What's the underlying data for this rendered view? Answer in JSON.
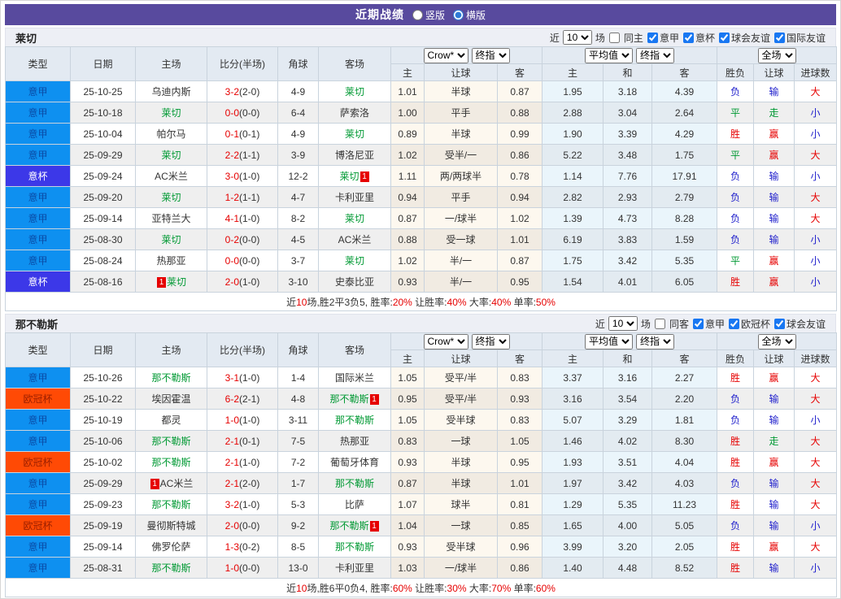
{
  "header": {
    "title": "近期战绩",
    "radio_vertical": "竖版",
    "radio_horizontal": "横版"
  },
  "table_header": {
    "cols": [
      "类型",
      "日期",
      "主场",
      "比分(半场)",
      "角球",
      "客场"
    ],
    "selects": {
      "book": "Crow*",
      "final1": "终指",
      "avg": "平均值",
      "final2": "终指",
      "scope": "全场"
    },
    "sub": [
      "主",
      "让球",
      "客",
      "主",
      "和",
      "客",
      "胜负",
      "让球",
      "进球数"
    ]
  },
  "sections": [
    {
      "team": "莱切",
      "filter": {
        "near": "近",
        "num": "10",
        "games": "场",
        "same": "同主",
        "leagues": [
          "意甲",
          "意杯",
          "球会友谊",
          "国际友谊"
        ]
      },
      "rows": [
        {
          "type": "意甲",
          "tc": "sa",
          "date": "25-10-25",
          "home": {
            "name": "乌迪内斯"
          },
          "ft": "3-2",
          "ht": "(2-0)",
          "corner": "4-9",
          "away": {
            "name": "莱切",
            "self": true
          },
          "odds": [
            "1.01",
            "半球",
            "0.87",
            "1.95",
            "3.18",
            "4.39"
          ],
          "res": [
            {
              "t": "负",
              "c": "b"
            },
            {
              "t": "输",
              "c": "b"
            },
            {
              "t": "大",
              "c": "r"
            }
          ]
        },
        {
          "type": "意甲",
          "tc": "sa",
          "date": "25-10-18",
          "home": {
            "name": "莱切",
            "self": true
          },
          "ft": "0-0",
          "ht": "(0-0)",
          "corner": "6-4",
          "away": {
            "name": "萨索洛"
          },
          "odds": [
            "1.00",
            "平手",
            "0.88",
            "2.88",
            "3.04",
            "2.64"
          ],
          "res": [
            {
              "t": "平",
              "c": "g"
            },
            {
              "t": "走",
              "c": "g"
            },
            {
              "t": "小",
              "c": "b"
            }
          ]
        },
        {
          "type": "意甲",
          "tc": "sa",
          "date": "25-10-04",
          "home": {
            "name": "帕尔马"
          },
          "ft": "0-1",
          "ht": "(0-1)",
          "corner": "4-9",
          "away": {
            "name": "莱切",
            "self": true
          },
          "odds": [
            "0.89",
            "半球",
            "0.99",
            "1.90",
            "3.39",
            "4.29"
          ],
          "res": [
            {
              "t": "胜",
              "c": "r"
            },
            {
              "t": "赢",
              "c": "r"
            },
            {
              "t": "小",
              "c": "b"
            }
          ]
        },
        {
          "type": "意甲",
          "tc": "sa",
          "date": "25-09-29",
          "home": {
            "name": "莱切",
            "self": true
          },
          "ft": "2-2",
          "ht": "(1-1)",
          "corner": "3-9",
          "away": {
            "name": "博洛尼亚"
          },
          "odds": [
            "1.02",
            "受半/一",
            "0.86",
            "5.22",
            "3.48",
            "1.75"
          ],
          "res": [
            {
              "t": "平",
              "c": "g"
            },
            {
              "t": "赢",
              "c": "r"
            },
            {
              "t": "大",
              "c": "r"
            }
          ]
        },
        {
          "type": "意杯",
          "tc": "ci",
          "date": "25-09-24",
          "home": {
            "name": "AC米兰"
          },
          "ft": "3-0",
          "ht": "(1-0)",
          "corner": "12-2",
          "away": {
            "name": "莱切",
            "self": true,
            "card": "1"
          },
          "odds": [
            "1.11",
            "两/两球半",
            "0.78",
            "1.14",
            "7.76",
            "17.91"
          ],
          "res": [
            {
              "t": "负",
              "c": "b"
            },
            {
              "t": "输",
              "c": "b"
            },
            {
              "t": "小",
              "c": "b"
            }
          ]
        },
        {
          "type": "意甲",
          "tc": "sa",
          "date": "25-09-20",
          "home": {
            "name": "莱切",
            "self": true
          },
          "ft": "1-2",
          "ht": "(1-1)",
          "corner": "4-7",
          "away": {
            "name": "卡利亚里"
          },
          "odds": [
            "0.94",
            "平手",
            "0.94",
            "2.82",
            "2.93",
            "2.79"
          ],
          "res": [
            {
              "t": "负",
              "c": "b"
            },
            {
              "t": "输",
              "c": "b"
            },
            {
              "t": "大",
              "c": "r"
            }
          ]
        },
        {
          "type": "意甲",
          "tc": "sa",
          "date": "25-09-14",
          "home": {
            "name": "亚特兰大"
          },
          "ft": "4-1",
          "ht": "(1-0)",
          "corner": "8-2",
          "away": {
            "name": "莱切",
            "self": true
          },
          "odds": [
            "0.87",
            "一/球半",
            "1.02",
            "1.39",
            "4.73",
            "8.28"
          ],
          "res": [
            {
              "t": "负",
              "c": "b"
            },
            {
              "t": "输",
              "c": "b"
            },
            {
              "t": "大",
              "c": "r"
            }
          ]
        },
        {
          "type": "意甲",
          "tc": "sa",
          "date": "25-08-30",
          "home": {
            "name": "莱切",
            "self": true
          },
          "ft": "0-2",
          "ht": "(0-0)",
          "corner": "4-5",
          "away": {
            "name": "AC米兰"
          },
          "odds": [
            "0.88",
            "受一球",
            "1.01",
            "6.19",
            "3.83",
            "1.59"
          ],
          "res": [
            {
              "t": "负",
              "c": "b"
            },
            {
              "t": "输",
              "c": "b"
            },
            {
              "t": "小",
              "c": "b"
            }
          ]
        },
        {
          "type": "意甲",
          "tc": "sa",
          "date": "25-08-24",
          "home": {
            "name": "热那亚"
          },
          "ft": "0-0",
          "ht": "(0-0)",
          "corner": "3-7",
          "away": {
            "name": "莱切",
            "self": true
          },
          "odds": [
            "1.02",
            "半/一",
            "0.87",
            "1.75",
            "3.42",
            "5.35"
          ],
          "res": [
            {
              "t": "平",
              "c": "g"
            },
            {
              "t": "赢",
              "c": "r"
            },
            {
              "t": "小",
              "c": "b"
            }
          ]
        },
        {
          "type": "意杯",
          "tc": "ci",
          "date": "25-08-16",
          "home": {
            "name": "莱切",
            "self": true,
            "card": "1"
          },
          "ft": "2-0",
          "ht": "(1-0)",
          "corner": "3-10",
          "away": {
            "name": "史泰比亚"
          },
          "odds": [
            "0.93",
            "半/一",
            "0.95",
            "1.54",
            "4.01",
            "6.05"
          ],
          "res": [
            {
              "t": "胜",
              "c": "r"
            },
            {
              "t": "赢",
              "c": "r"
            },
            {
              "t": "小",
              "c": "b"
            }
          ]
        }
      ],
      "summary": [
        {
          "t": "近",
          "c": "k"
        },
        {
          "t": "10",
          "c": "r"
        },
        {
          "t": "场,胜2平3负5, 胜率:",
          "c": "k"
        },
        {
          "t": "20%",
          "c": "r"
        },
        {
          "t": " 让胜率:",
          "c": "k"
        },
        {
          "t": "40%",
          "c": "r"
        },
        {
          "t": " 大率:",
          "c": "k"
        },
        {
          "t": "40%",
          "c": "r"
        },
        {
          "t": " 单率:",
          "c": "k"
        },
        {
          "t": "50%",
          "c": "r"
        }
      ]
    },
    {
      "team": "那不勒斯",
      "filter": {
        "near": "近",
        "num": "10",
        "games": "场",
        "same": "同客",
        "leagues": [
          "意甲",
          "欧冠杯",
          "球会友谊"
        ]
      },
      "rows": [
        {
          "type": "意甲",
          "tc": "sa",
          "date": "25-10-26",
          "home": {
            "name": "那不勒斯",
            "self": true
          },
          "ft": "3-1",
          "ht": "(1-0)",
          "corner": "1-4",
          "away": {
            "name": "国际米兰"
          },
          "odds": [
            "1.05",
            "受平/半",
            "0.83",
            "3.37",
            "3.16",
            "2.27"
          ],
          "res": [
            {
              "t": "胜",
              "c": "r"
            },
            {
              "t": "赢",
              "c": "r"
            },
            {
              "t": "大",
              "c": "r"
            }
          ]
        },
        {
          "type": "欧冠杯",
          "tc": "ucl",
          "date": "25-10-22",
          "home": {
            "name": "埃因霍温"
          },
          "ft": "6-2",
          "ht": "(2-1)",
          "corner": "4-8",
          "away": {
            "name": "那不勒斯",
            "self": true,
            "card": "1"
          },
          "odds": [
            "0.95",
            "受平/半",
            "0.93",
            "3.16",
            "3.54",
            "2.20"
          ],
          "res": [
            {
              "t": "负",
              "c": "b"
            },
            {
              "t": "输",
              "c": "b"
            },
            {
              "t": "大",
              "c": "r"
            }
          ]
        },
        {
          "type": "意甲",
          "tc": "sa",
          "date": "25-10-19",
          "home": {
            "name": "都灵"
          },
          "ft": "1-0",
          "ht": "(1-0)",
          "corner": "3-11",
          "away": {
            "name": "那不勒斯",
            "self": true
          },
          "odds": [
            "1.05",
            "受半球",
            "0.83",
            "5.07",
            "3.29",
            "1.81"
          ],
          "res": [
            {
              "t": "负",
              "c": "b"
            },
            {
              "t": "输",
              "c": "b"
            },
            {
              "t": "小",
              "c": "b"
            }
          ]
        },
        {
          "type": "意甲",
          "tc": "sa",
          "date": "25-10-06",
          "home": {
            "name": "那不勒斯",
            "self": true
          },
          "ft": "2-1",
          "ht": "(0-1)",
          "corner": "7-5",
          "away": {
            "name": "热那亚"
          },
          "odds": [
            "0.83",
            "一球",
            "1.05",
            "1.46",
            "4.02",
            "8.30"
          ],
          "res": [
            {
              "t": "胜",
              "c": "r"
            },
            {
              "t": "走",
              "c": "g"
            },
            {
              "t": "大",
              "c": "r"
            }
          ]
        },
        {
          "type": "欧冠杯",
          "tc": "ucl",
          "date": "25-10-02",
          "home": {
            "name": "那不勒斯",
            "self": true
          },
          "ft": "2-1",
          "ht": "(1-0)",
          "corner": "7-2",
          "away": {
            "name": "葡萄牙体育"
          },
          "odds": [
            "0.93",
            "半球",
            "0.95",
            "1.93",
            "3.51",
            "4.04"
          ],
          "res": [
            {
              "t": "胜",
              "c": "r"
            },
            {
              "t": "赢",
              "c": "r"
            },
            {
              "t": "大",
              "c": "r"
            }
          ]
        },
        {
          "type": "意甲",
          "tc": "sa",
          "date": "25-09-29",
          "home": {
            "name": "AC米兰",
            "card": "1"
          },
          "ft": "2-1",
          "ht": "(2-0)",
          "corner": "1-7",
          "away": {
            "name": "那不勒斯",
            "self": true
          },
          "odds": [
            "0.87",
            "半球",
            "1.01",
            "1.97",
            "3.42",
            "4.03"
          ],
          "res": [
            {
              "t": "负",
              "c": "b"
            },
            {
              "t": "输",
              "c": "b"
            },
            {
              "t": "大",
              "c": "r"
            }
          ]
        },
        {
          "type": "意甲",
          "tc": "sa",
          "date": "25-09-23",
          "home": {
            "name": "那不勒斯",
            "self": true
          },
          "ft": "3-2",
          "ht": "(1-0)",
          "corner": "5-3",
          "away": {
            "name": "比萨"
          },
          "odds": [
            "1.07",
            "球半",
            "0.81",
            "1.29",
            "5.35",
            "11.23"
          ],
          "res": [
            {
              "t": "胜",
              "c": "r"
            },
            {
              "t": "输",
              "c": "b"
            },
            {
              "t": "大",
              "c": "r"
            }
          ]
        },
        {
          "type": "欧冠杯",
          "tc": "ucl",
          "date": "25-09-19",
          "home": {
            "name": "曼彻斯特城"
          },
          "ft": "2-0",
          "ht": "(0-0)",
          "corner": "9-2",
          "away": {
            "name": "那不勒斯",
            "self": true,
            "card": "1"
          },
          "odds": [
            "1.04",
            "一球",
            "0.85",
            "1.65",
            "4.00",
            "5.05"
          ],
          "res": [
            {
              "t": "负",
              "c": "b"
            },
            {
              "t": "输",
              "c": "b"
            },
            {
              "t": "小",
              "c": "b"
            }
          ]
        },
        {
          "type": "意甲",
          "tc": "sa",
          "date": "25-09-14",
          "home": {
            "name": "佛罗伦萨"
          },
          "ft": "1-3",
          "ht": "(0-2)",
          "corner": "8-5",
          "away": {
            "name": "那不勒斯",
            "self": true
          },
          "odds": [
            "0.93",
            "受半球",
            "0.96",
            "3.99",
            "3.20",
            "2.05"
          ],
          "res": [
            {
              "t": "胜",
              "c": "r"
            },
            {
              "t": "赢",
              "c": "r"
            },
            {
              "t": "大",
              "c": "r"
            }
          ]
        },
        {
          "type": "意甲",
          "tc": "sa",
          "date": "25-08-31",
          "home": {
            "name": "那不勒斯",
            "self": true
          },
          "ft": "1-0",
          "ht": "(0-0)",
          "corner": "13-0",
          "away": {
            "name": "卡利亚里"
          },
          "odds": [
            "1.03",
            "一/球半",
            "0.86",
            "1.40",
            "4.48",
            "8.52"
          ],
          "res": [
            {
              "t": "胜",
              "c": "r"
            },
            {
              "t": "输",
              "c": "b"
            },
            {
              "t": "小",
              "c": "b"
            }
          ]
        }
      ],
      "summary": [
        {
          "t": "近",
          "c": "k"
        },
        {
          "t": "10",
          "c": "r"
        },
        {
          "t": "场,胜6平0负4, 胜率:",
          "c": "k"
        },
        {
          "t": "60%",
          "c": "r"
        },
        {
          "t": " 让胜率:",
          "c": "k"
        },
        {
          "t": "30%",
          "c": "r"
        },
        {
          "t": " 大率:",
          "c": "k"
        },
        {
          "t": "70%",
          "c": "r"
        },
        {
          "t": " 单率:",
          "c": "k"
        },
        {
          "t": "60%",
          "c": "r"
        }
      ]
    }
  ],
  "colors": {
    "accent_purple": "#584a9e",
    "serie_a_blue": "#0e90f0",
    "coppa_indigo": "#3c38e8",
    "ucl_orange": "#ff4a05",
    "win_red": "#e60000",
    "lose_blue": "#2020cc",
    "draw_green": "#009933"
  }
}
